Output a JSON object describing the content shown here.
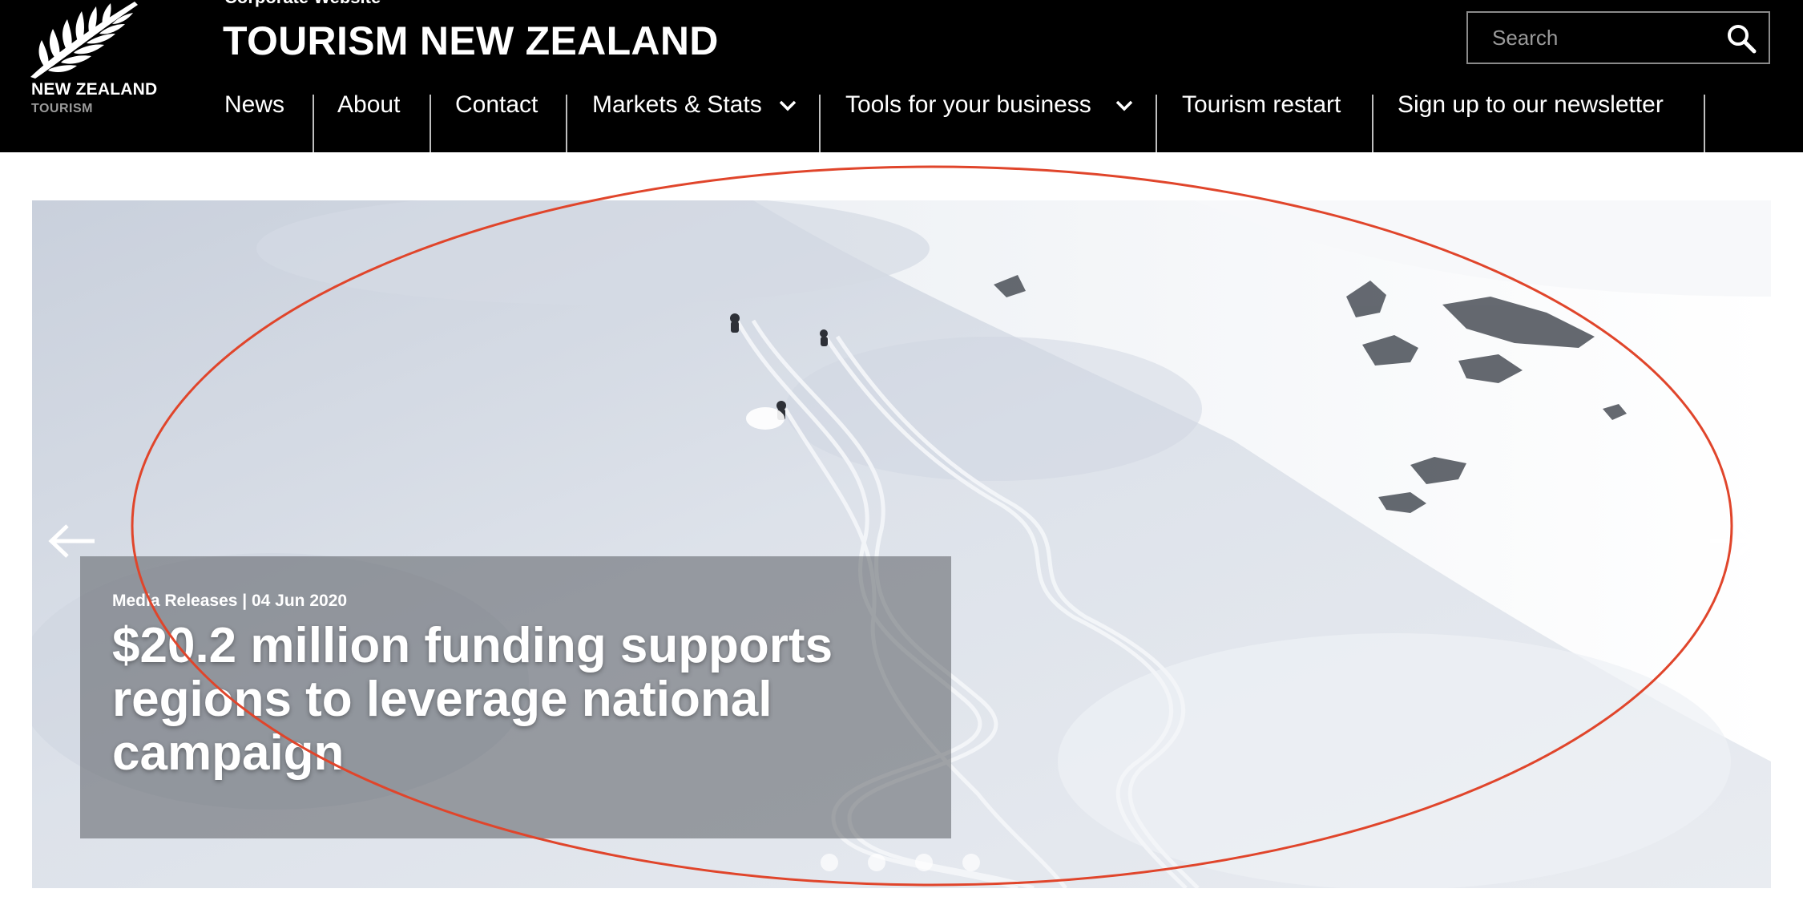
{
  "header": {
    "logo_line1": "NEW ZEALAND",
    "logo_line2": "TOURISM",
    "corporate_label": "Corporate Website",
    "site_title": "TOURISM NEW ZEALAND",
    "background_color": "#000000"
  },
  "search": {
    "placeholder": "Search",
    "value": "",
    "icon": "search-icon"
  },
  "nav": {
    "items": [
      {
        "label": "News",
        "has_dropdown": false
      },
      {
        "label": "About",
        "has_dropdown": false
      },
      {
        "label": "Contact",
        "has_dropdown": false
      },
      {
        "label": "Markets & Stats",
        "has_dropdown": true
      },
      {
        "label": "Tools for your business",
        "has_dropdown": true
      },
      {
        "label": "Tourism restart",
        "has_dropdown": false
      },
      {
        "label": "Sign up to our newsletter",
        "has_dropdown": false
      }
    ]
  },
  "hero": {
    "caption_meta": "Media Releases | 04 Jun 2020",
    "caption_title": "$20.2 million funding supports regions to leverage national campaign",
    "prev_icon": "arrow-left-icon",
    "next_icon": "arrow-right-icon",
    "slide_count": 4,
    "active_slide": 1,
    "annotation_color": "#e0452b"
  }
}
